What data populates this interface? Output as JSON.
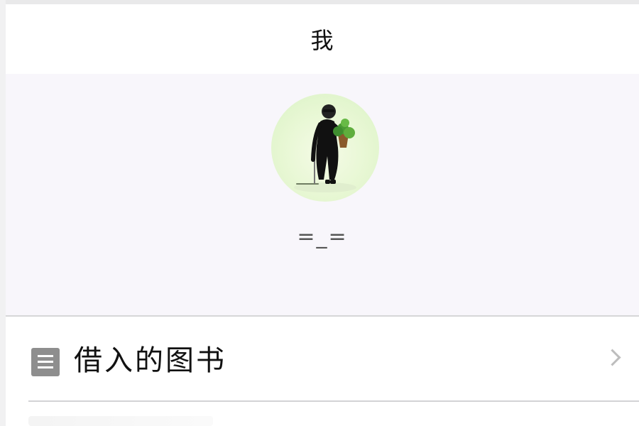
{
  "header": {
    "title": "我"
  },
  "profile": {
    "nickname": "=_=",
    "avatar_icon": "avatar-icon"
  },
  "menu": {
    "items": [
      {
        "label": "借入的图书",
        "icon": "book-list-icon",
        "chevron_icon": "chevron-right-icon"
      }
    ]
  },
  "colors": {
    "header_background": "#ffffff",
    "profile_background": "#f8f6fb",
    "title_text": "#111111",
    "nickname_text": "#555555",
    "icon_gray": "#8e8e8e",
    "chevron_gray": "#bdbdbd",
    "divider": "#d3d3d5"
  }
}
